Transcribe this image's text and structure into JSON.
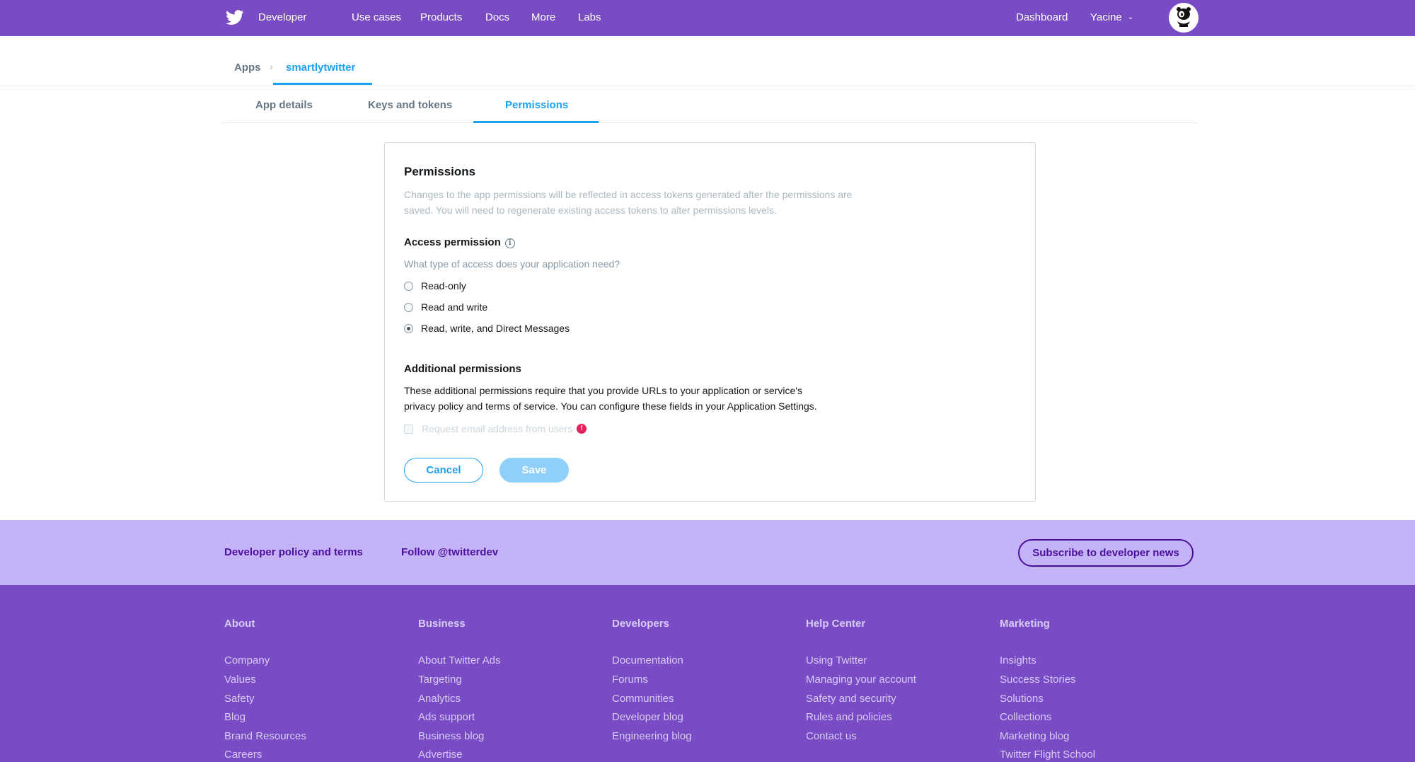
{
  "nav": {
    "brand": "Developer",
    "items": [
      "Use cases",
      "Products",
      "Docs",
      "More",
      "Labs"
    ],
    "dashboard": "Dashboard",
    "user": "Yacine"
  },
  "breadcrumb": {
    "root": "Apps",
    "current": "smartlytwitter"
  },
  "tabs": [
    "App details",
    "Keys and tokens",
    "Permissions"
  ],
  "active_tab": "Permissions",
  "card": {
    "title": "Permissions",
    "subtitle_line1": "Changes to the app permissions will be reflected in access tokens generated after the permissions are",
    "subtitle_line2": "saved. You will need to regenerate existing access tokens to alter permissions levels.",
    "access_heading": "Access permission",
    "access_question": "What type of access does your application need?",
    "options": [
      "Read-only",
      "Read and write",
      "Read, write, and Direct Messages"
    ],
    "selected_option": "Read, write, and Direct Messages",
    "additional_heading": "Additional permissions",
    "additional_line1": "These additional permissions require that you provide URLs to your application or service's",
    "additional_line2": "privacy policy and terms of service. You can configure these fields in your Application Settings.",
    "email_checkbox_label": "Request email address from users",
    "cancel_label": "Cancel",
    "save_label": "Save"
  },
  "strip": {
    "policy": "Developer policy and terms",
    "follow": "Follow @twitterdev",
    "subscribe": "Subscribe to developer news"
  },
  "footer": {
    "columns": [
      {
        "heading": "About",
        "links": [
          "Company",
          "Values",
          "Safety",
          "Blog",
          "Brand Resources",
          "Careers"
        ]
      },
      {
        "heading": "Business",
        "links": [
          "About Twitter Ads",
          "Targeting",
          "Analytics",
          "Ads support",
          "Business blog",
          "Advertise"
        ]
      },
      {
        "heading": "Developers",
        "links": [
          "Documentation",
          "Forums",
          "Communities",
          "Developer blog",
          "Engineering blog"
        ]
      },
      {
        "heading": "Help Center",
        "links": [
          "Using Twitter",
          "Managing your account",
          "Safety and security",
          "Rules and policies",
          "Contact us"
        ]
      },
      {
        "heading": "Marketing",
        "links": [
          "Insights",
          "Success Stories",
          "Solutions",
          "Collections",
          "Marketing blog",
          "Twitter Flight School"
        ]
      }
    ]
  },
  "colors": {
    "nav_bg": "#794bc4",
    "accent_blue": "#1da1f2",
    "strip_bg": "#c5b3f7",
    "strip_text": "#4b0f9c",
    "alert": "#e0245e"
  },
  "icons": {
    "brand": "twitter-bird-icon",
    "user_menu": "chevron-down-icon",
    "avatar": "wwf-panda-avatar",
    "breadcrumb_sep": "chevron-right-icon",
    "access_info": "info-icon",
    "email_alert": "alert-icon"
  }
}
